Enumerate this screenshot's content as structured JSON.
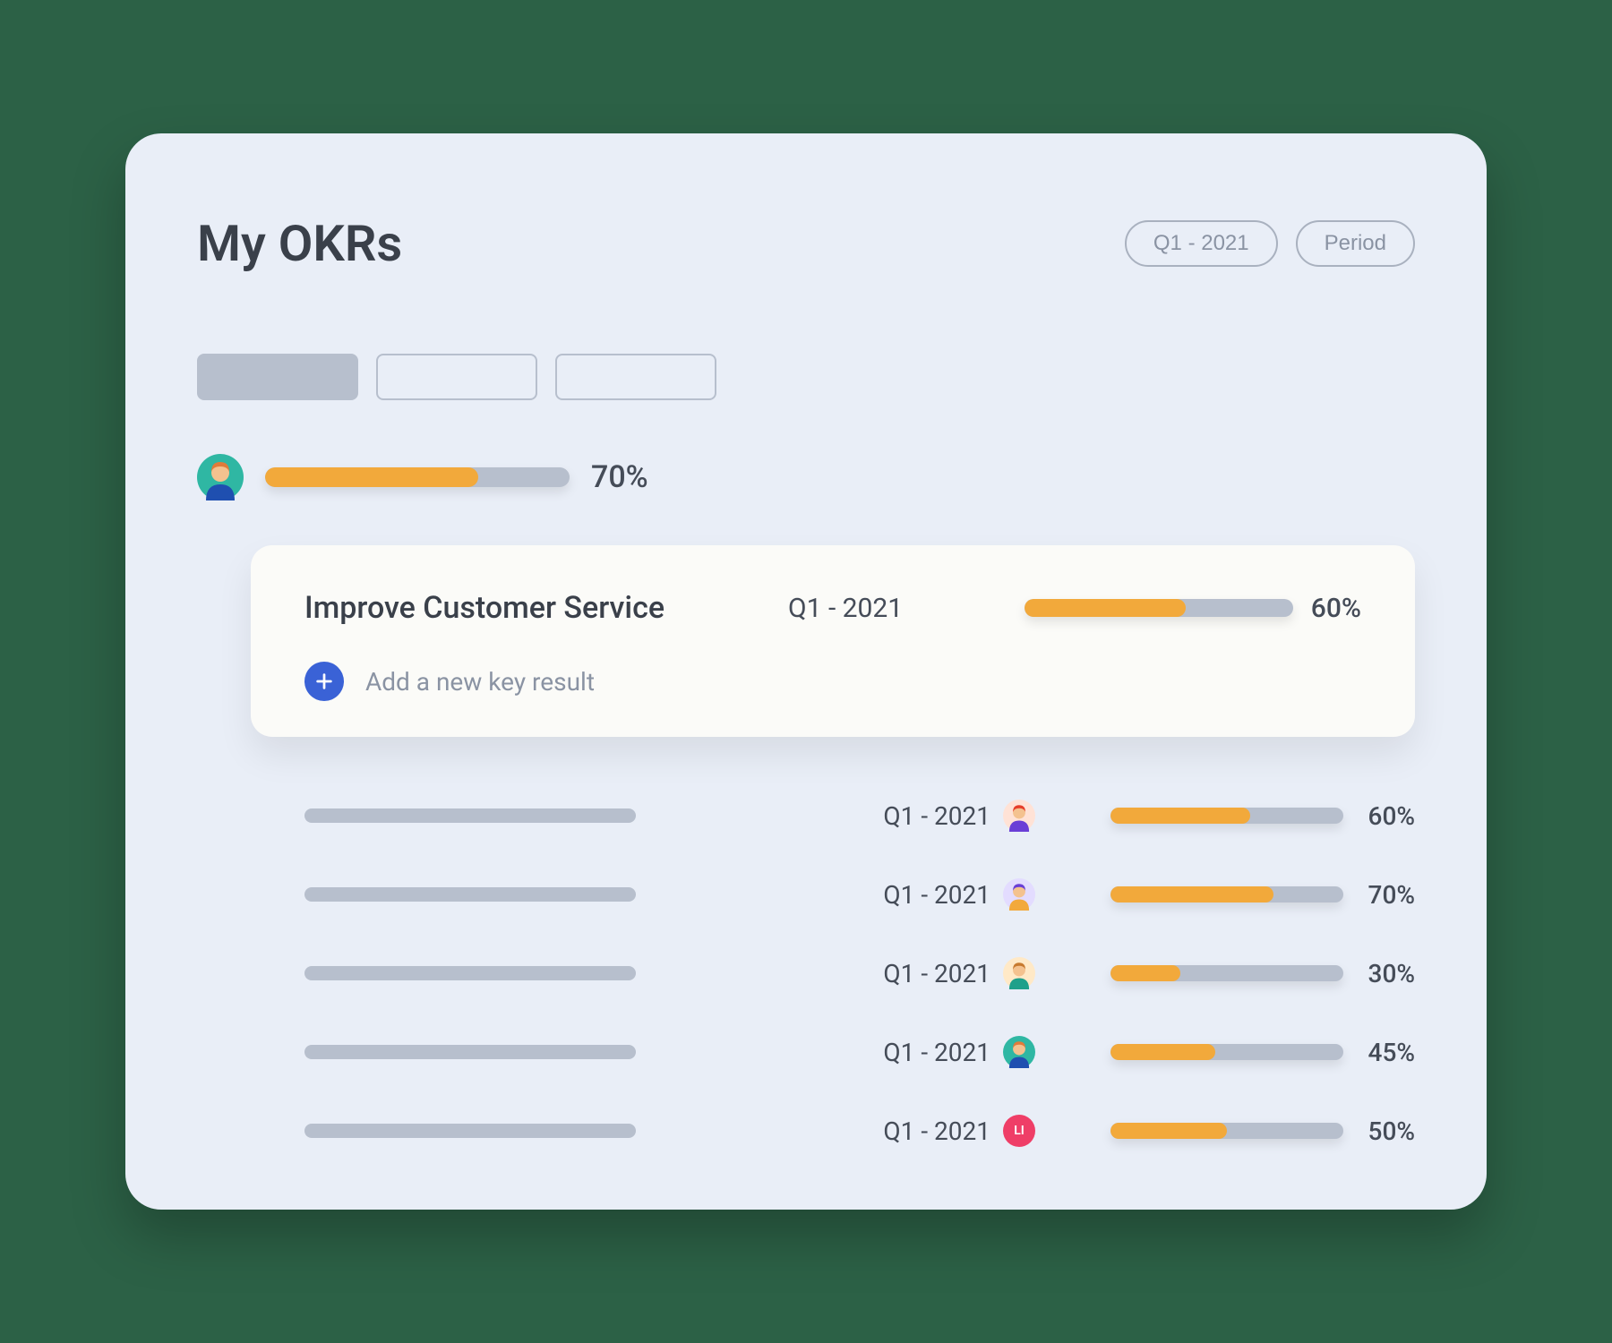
{
  "header": {
    "title": "My OKRs",
    "period_pill": "Q1 - 2021",
    "period_label": "Period"
  },
  "tabs": [
    {
      "active": true
    },
    {
      "active": false
    },
    {
      "active": false
    }
  ],
  "overall": {
    "progress": 70,
    "progress_label": "70%",
    "avatar": {
      "bg": "#2fb7a3",
      "hair": "#e07b3a",
      "skin": "#f4c28f",
      "shirt": "#1f4fb0"
    }
  },
  "objective": {
    "title": "Improve Customer Service",
    "period": "Q1 - 2021",
    "progress": 60,
    "progress_label": "60%",
    "add_label": "Add a new key result"
  },
  "key_results": [
    {
      "period": "Q1 - 2021",
      "progress": 60,
      "progress_label": "60%",
      "avatar": {
        "type": "svg",
        "bg": "#ffe2d6",
        "hair": "#e63e2a",
        "skin": "#f4c28f",
        "shirt": "#6a3fd6"
      }
    },
    {
      "period": "Q1 - 2021",
      "progress": 70,
      "progress_label": "70%",
      "avatar": {
        "type": "svg",
        "bg": "#e3dcff",
        "hair": "#6a3fd6",
        "skin": "#f4c28f",
        "shirt": "#f2a93b"
      }
    },
    {
      "period": "Q1 - 2021",
      "progress": 30,
      "progress_label": "30%",
      "avatar": {
        "type": "svg",
        "bg": "#ffe9c7",
        "hair": "#c77a2f",
        "skin": "#f4c28f",
        "shirt": "#1fa08a"
      }
    },
    {
      "period": "Q1 - 2021",
      "progress": 45,
      "progress_label": "45%",
      "avatar": {
        "type": "svg",
        "bg": "#2fb7a3",
        "hair": "#e07b3a",
        "skin": "#f4c28f",
        "shirt": "#1f4fb0"
      }
    },
    {
      "period": "Q1 - 2021",
      "progress": 50,
      "progress_label": "50%",
      "avatar": {
        "type": "initials",
        "bg": "#ef3e67",
        "text": "LI"
      }
    }
  ],
  "colors": {
    "accent": "#f2a93b",
    "track": "#b7bfcd",
    "add_btn": "#3a62d6"
  }
}
